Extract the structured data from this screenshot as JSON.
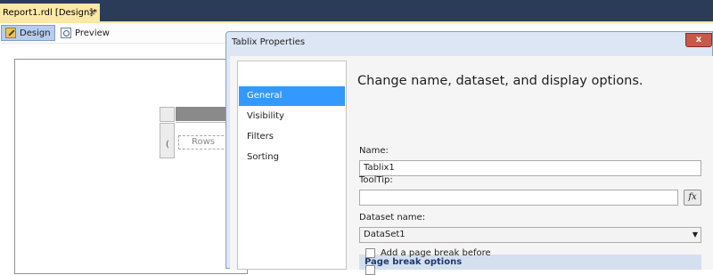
{
  "document_tab": {
    "label": "Report1.rdl [Design]*",
    "close_glyph": "×"
  },
  "view_tabs": [
    {
      "label": "Design",
      "icon": "design-icon",
      "active": true
    },
    {
      "label": "Preview",
      "icon": "preview-icon",
      "active": false
    }
  ],
  "tablix": {
    "row_group_label": "Rows",
    "row_handle_glyph": "("
  },
  "dialog": {
    "title": "Tablix Properties",
    "close_glyph": "x",
    "nav": [
      {
        "label": "General",
        "selected": true
      },
      {
        "label": "Visibility",
        "selected": false
      },
      {
        "label": "Filters",
        "selected": false
      },
      {
        "label": "Sorting",
        "selected": false
      }
    ],
    "heading": "Change name, dataset, and display options.",
    "name_label": "Name:",
    "name_value": "Tablix1",
    "tooltip_label": "ToolTip:",
    "tooltip_value": "",
    "fx_label": "fx",
    "dataset_label": "Dataset name:",
    "dataset_value": "DataSet1",
    "dropdown_glyph": "▼",
    "page_break_header": "Page break options",
    "page_break_before_label": "Add a page break before"
  },
  "colors": {
    "tabstrip": "#2b3c59",
    "active_doc_tab": "#ffe8a6",
    "nav_selected": "#3399ff",
    "dialog_frame": "#dce6f4",
    "close_button": "#c8594a",
    "section_header": "#d4e0ef"
  }
}
